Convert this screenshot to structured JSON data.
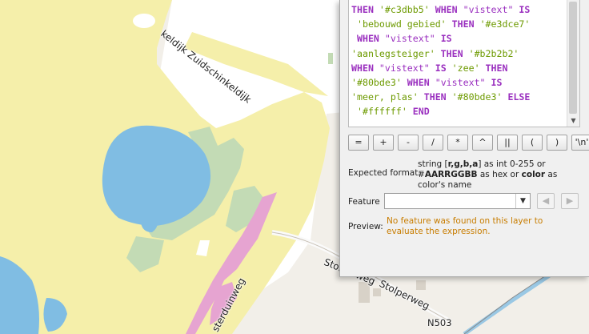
{
  "map": {
    "road_labels": {
      "zuidschinkeldijk": "keldijk Zuidschinkeldijk",
      "stolperweg_1": "Stolperweg",
      "stolperweg_2": "Stolperweg",
      "duinweg": "sterduinweg",
      "route": "N503"
    },
    "colors": {
      "background": "#f2efe9",
      "bebouwd_gebied": "#e3dce7",
      "zee_meer": "#80bde3",
      "vegetation": "#c3dbb5",
      "duin": "#f5efaa",
      "pink": "#e6a4d1"
    }
  },
  "expression_panel": {
    "code_lines": [
      [
        {
          "t": "THEN ",
          "c": "kw"
        },
        {
          "t": "'#c3dbb5'",
          "c": "str"
        },
        {
          "t": " WHEN ",
          "c": "kw"
        },
        {
          "t": "\"vistext\"",
          "c": "fld"
        },
        {
          "t": " IS",
          "c": "kw"
        }
      ],
      [
        {
          "t": " ",
          "c": ""
        },
        {
          "t": "'bebouwd gebied'",
          "c": "str"
        },
        {
          "t": " THEN ",
          "c": "kw"
        },
        {
          "t": "'#e3dce7'",
          "c": "str"
        }
      ],
      [
        {
          "t": " WHEN ",
          "c": "kw"
        },
        {
          "t": "\"vistext\"",
          "c": "fld"
        },
        {
          "t": " IS",
          "c": "kw"
        }
      ],
      [
        {
          "t": "'aanlegsteiger'",
          "c": "str"
        },
        {
          "t": " THEN ",
          "c": "kw"
        },
        {
          "t": "'#b2b2b2'",
          "c": "str"
        }
      ],
      [
        {
          "t": "WHEN ",
          "c": "kw"
        },
        {
          "t": "\"vistext\"",
          "c": "fld"
        },
        {
          "t": " IS ",
          "c": "kw"
        },
        {
          "t": "'zee'",
          "c": "str"
        },
        {
          "t": " THEN",
          "c": "kw"
        }
      ],
      [
        {
          "t": "'#80bde3'",
          "c": "str"
        },
        {
          "t": " WHEN ",
          "c": "kw"
        },
        {
          "t": "\"vistext\"",
          "c": "fld"
        },
        {
          "t": " IS",
          "c": "kw"
        }
      ],
      [
        {
          "t": "'meer, plas'",
          "c": "str"
        },
        {
          "t": " THEN ",
          "c": "kw"
        },
        {
          "t": "'#80bde3'",
          "c": "str"
        },
        {
          "t": " ELSE",
          "c": "kw"
        }
      ],
      [
        {
          "t": " ",
          "c": ""
        },
        {
          "t": "'#ffffff'",
          "c": "str"
        },
        {
          "t": " END",
          "c": "kw"
        }
      ]
    ],
    "operators": [
      "=",
      "+",
      "-",
      "/",
      "*",
      "^",
      "||",
      "(",
      ")",
      "'\\n'"
    ],
    "expected_format_label": "Expected format:",
    "expected_format_text": [
      {
        "t": "string [",
        "b": false
      },
      {
        "t": "r,g,b,a",
        "b": true
      },
      {
        "t": "] as int 0-255 or #",
        "b": false
      },
      {
        "t": "AARRGGBB",
        "b": true
      },
      {
        "t": " as hex or ",
        "b": false
      },
      {
        "t": "color",
        "b": true
      },
      {
        "t": " as color's name",
        "b": false
      }
    ],
    "feature_label": "Feature",
    "feature_value": "",
    "preview_label": "Preview:",
    "preview_text": "No feature was found on this layer to evaluate the expression.",
    "icons": {
      "dropdown": "chevron-down-icon",
      "prev": "triangle-left-icon",
      "next": "triangle-right-icon"
    }
  }
}
